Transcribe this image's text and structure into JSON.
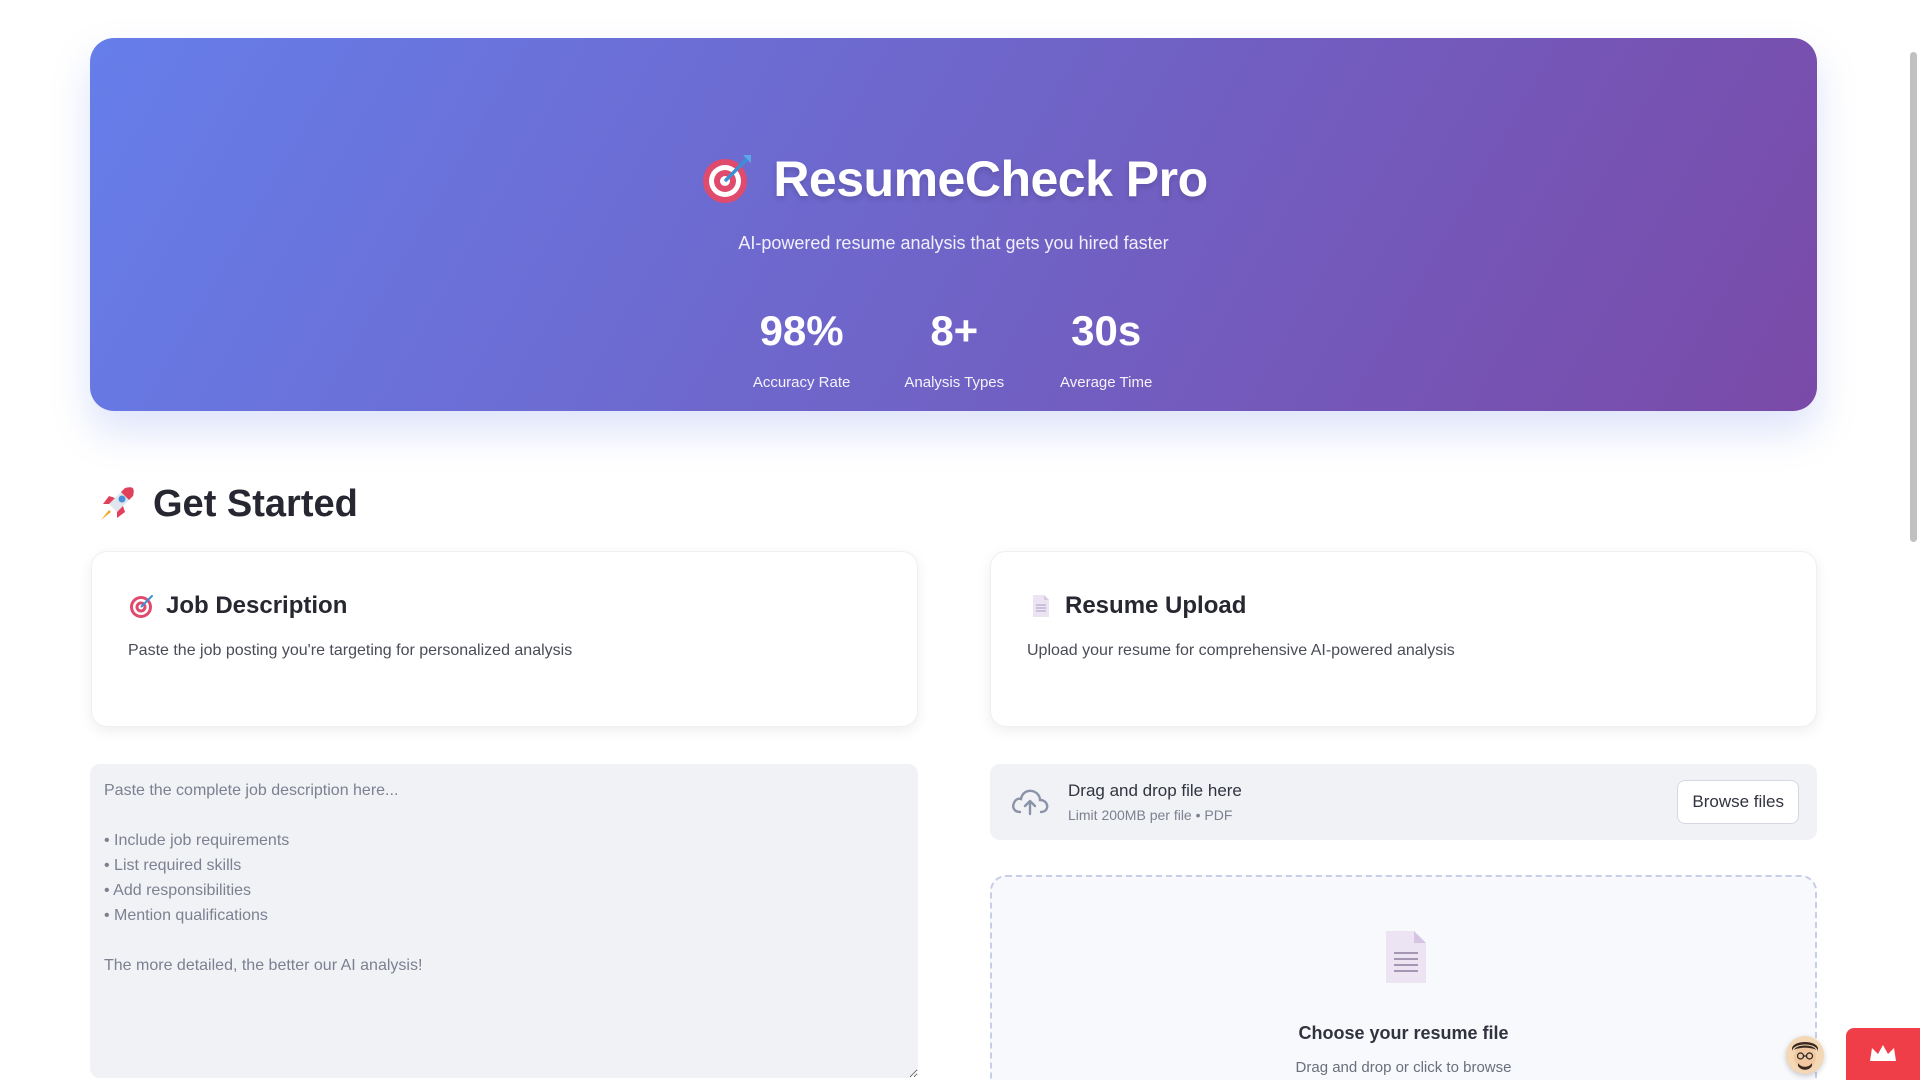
{
  "hero": {
    "title": "ResumeCheck Pro",
    "subtitle": "AI-powered resume analysis that gets you hired faster",
    "stats": [
      {
        "value": "98%",
        "label": "Accuracy Rate"
      },
      {
        "value": "8+",
        "label": "Analysis Types"
      },
      {
        "value": "30s",
        "label": "Average Time"
      }
    ],
    "gradient_colors": [
      "#667eea",
      "#764ba2"
    ]
  },
  "get_started": {
    "title": "Get Started",
    "icon": "rocket-icon"
  },
  "job_card": {
    "icon": "target-icon",
    "title": "Job Description",
    "description": "Paste the job posting you're targeting for personalized analysis"
  },
  "resume_card": {
    "icon": "document-icon",
    "title": "Resume Upload",
    "description": "Upload your resume for comprehensive AI-powered analysis"
  },
  "job_input": {
    "value": "",
    "placeholder": "Paste the complete job description here...\n\n• Include job requirements\n• List required skills\n• Add responsibilities\n• Mention qualifications\n\nThe more detailed, the better our AI analysis!"
  },
  "uploader": {
    "main_text": "Drag and drop file here",
    "limit_text": "Limit 200MB per file • PDF",
    "browse_label": "Browse files"
  },
  "dropzone": {
    "title": "Choose your resume file",
    "subtitle": "Drag and drop or click to browse"
  },
  "colors": {
    "accent_badge": "#f03e48",
    "input_bg": "#f0f2f6"
  }
}
